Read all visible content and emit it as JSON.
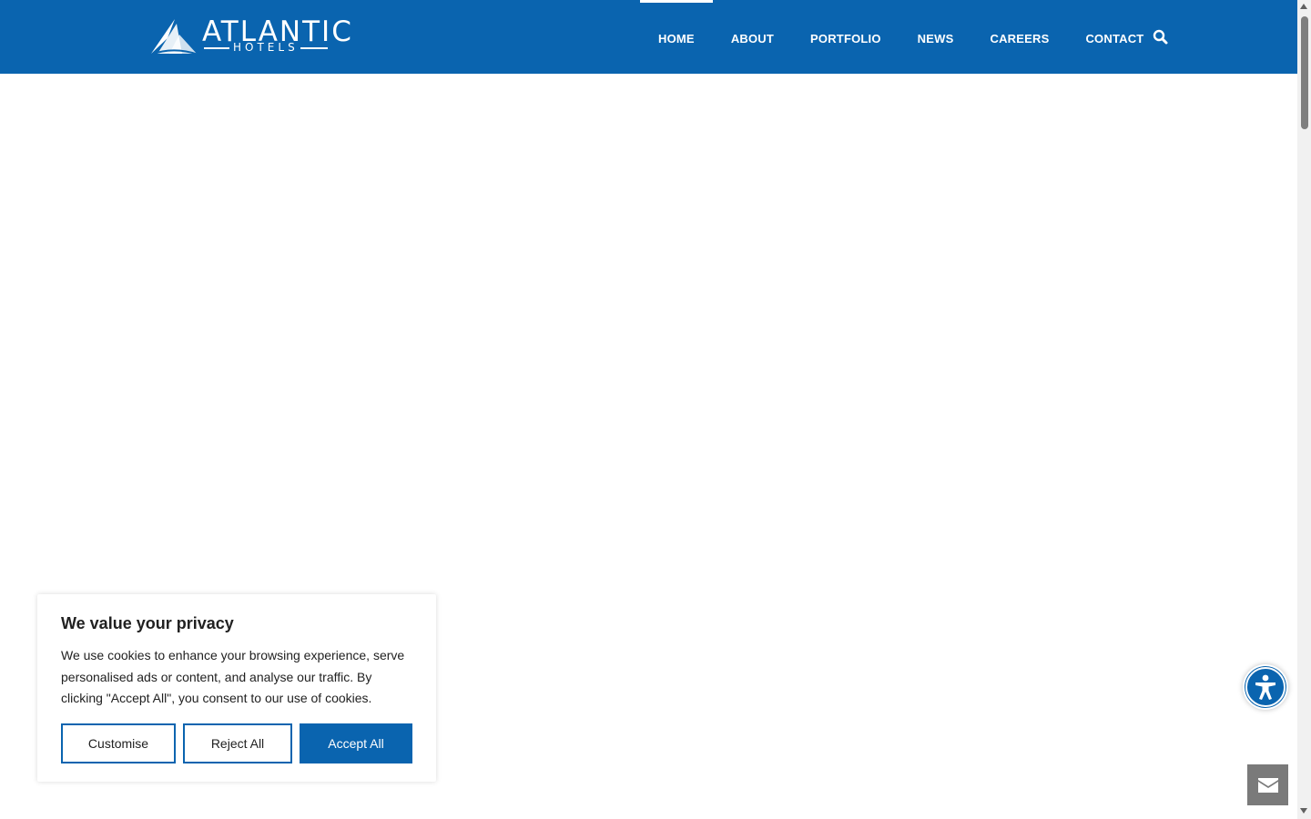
{
  "brand": {
    "name": "ATLANTIC",
    "sub": "HOTELS"
  },
  "nav": {
    "items": [
      {
        "label": "HOME",
        "active": true
      },
      {
        "label": "ABOUT",
        "active": false
      },
      {
        "label": "PORTFOLIO",
        "active": false
      },
      {
        "label": "NEWS",
        "active": false
      },
      {
        "label": "CAREERS",
        "active": false
      },
      {
        "label": "CONTACT",
        "active": false
      }
    ],
    "search_icon": "search-icon"
  },
  "cookie": {
    "title": "We value your privacy",
    "text": "We use cookies to enhance your browsing experience, serve personalised ads or content, and analyse our traffic. By clicking \"Accept All\", you consent to our use of cookies.",
    "customise_label": "Customise",
    "reject_label": "Reject All",
    "accept_label": "Accept All"
  },
  "widgets": {
    "accessibility_icon": "accessibility-icon",
    "contact_icon": "envelope-icon"
  },
  "colors": {
    "brand_blue": "#0a64af",
    "contact_button": "#7a7a7a"
  }
}
